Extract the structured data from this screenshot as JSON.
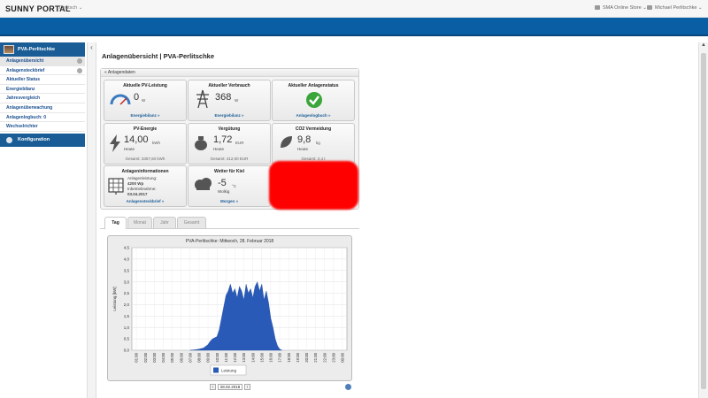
{
  "app": {
    "logo": "SUNNY PORTAL",
    "language": "Deutsch ⌄",
    "shop": "SMA Online Store ⌄",
    "user": "Michael Perlitschke ⌄"
  },
  "sidebar": {
    "plant_name": "PVA-Perlitschke",
    "items": [
      {
        "label": "Anlagenübersicht"
      },
      {
        "label": "Anlagensteckbrief"
      },
      {
        "label": "Aktueller Status"
      },
      {
        "label": "Energiebilanz"
      },
      {
        "label": "Jahresvergleich"
      },
      {
        "label": "Anlagenüberwachung"
      },
      {
        "label": "Anlagenlogbuch: 0"
      },
      {
        "label": "Wechselrichter"
      }
    ],
    "config_label": "Konfiguration"
  },
  "nav": {
    "collapse": "‹",
    "scroll_up": "▲",
    "scroll_down": "▼"
  },
  "page": {
    "title": "Anlagenübersicht | PVA-Perlitschke"
  },
  "panel": {
    "header": "« Anlagendaten"
  },
  "tiles": {
    "pv": {
      "title": "Aktuelle PV-Leistung",
      "value": "0",
      "unit": "W",
      "link": "Energiebilanz »"
    },
    "consumption": {
      "title": "Aktueller Verbrauch",
      "value": "368",
      "unit": "W",
      "link": "Energiebilanz »"
    },
    "status": {
      "title": "Aktueller Anlagenstatus",
      "link": "Anlagenlogbuch »"
    },
    "energy": {
      "title": "PV-Energie",
      "value": "14,00",
      "unit": "kWh",
      "sub": "Heute",
      "foot": "Gesamt: 3357,60 kWh"
    },
    "compensation": {
      "title": "Vergütung",
      "value": "1,72",
      "unit": "EUR",
      "sub": "Heute",
      "foot": "Gesamt: 412,00 EUR"
    },
    "co2": {
      "title": "CO2 Vermeidung",
      "value": "9,8",
      "unit": "kg",
      "sub": "Heute",
      "foot": "Gesamt: 2,4 t"
    },
    "info": {
      "title": "Anlageninformationen",
      "line1": "Anlagenleistung:",
      "line2": "4200 Wp",
      "line3": "Inbetriebnahme:",
      "line4": "03.04.2017",
      "link": "Anlagensteckbrief »"
    },
    "weather": {
      "title": "Wetter für Kiel",
      "value": "-5",
      "unit": "°C",
      "sub": "Wolkig",
      "link": "Morgen »"
    }
  },
  "tabs": [
    "Tag",
    "Monat",
    "Jahr",
    "Gesamt"
  ],
  "chart_data": {
    "type": "area",
    "title": "PVA-Perlitschke: Mittwoch, 28. Februar 2018",
    "ylabel": "Leistung [kW]",
    "ylim": [
      0,
      4.5
    ],
    "yticks": [
      "0,0",
      "0,5",
      "1,0",
      "1,5",
      "2,0",
      "2,5",
      "3,0",
      "3,5",
      "4,0",
      "4,5"
    ],
    "xticks": [
      "01:00",
      "02:00",
      "03:00",
      "04:00",
      "05:00",
      "06:00",
      "07:00",
      "08:00",
      "09:00",
      "10:00",
      "11:00",
      "12:00",
      "13:00",
      "14:00",
      "15:00",
      "16:00",
      "17:00",
      "18:00",
      "19:00",
      "20:00",
      "21:00",
      "22:00",
      "23:00",
      "00:00"
    ],
    "x": [
      7.0,
      7.5,
      8.0,
      8.5,
      9.0,
      9.25,
      9.5,
      10.0,
      10.25,
      10.5,
      10.75,
      11.0,
      11.25,
      11.5,
      11.75,
      12.0,
      12.25,
      12.5,
      12.75,
      13.0,
      13.25,
      13.5,
      13.75,
      14.0,
      14.25,
      14.5,
      14.75,
      15.0,
      15.25,
      15.5,
      15.75,
      16.0,
      16.25,
      16.5,
      16.75,
      17.0,
      17.25
    ],
    "series": [
      {
        "name": "Leistung",
        "color": "#2a5ab8",
        "values": [
          0.0,
          0.02,
          0.05,
          0.1,
          0.25,
          0.4,
          0.5,
          0.6,
          0.9,
          1.4,
          1.9,
          2.4,
          2.6,
          2.9,
          2.5,
          2.7,
          2.3,
          2.8,
          2.6,
          2.2,
          2.9,
          2.5,
          2.7,
          2.3,
          2.8,
          3.0,
          2.6,
          2.9,
          2.2,
          2.6,
          2.1,
          1.4,
          1.0,
          0.5,
          0.2,
          0.05,
          0.0
        ]
      }
    ],
    "legend": "bottom-center"
  },
  "chart_nav": {
    "prev": "‹",
    "date": "28.02.2018",
    "next": "›"
  }
}
